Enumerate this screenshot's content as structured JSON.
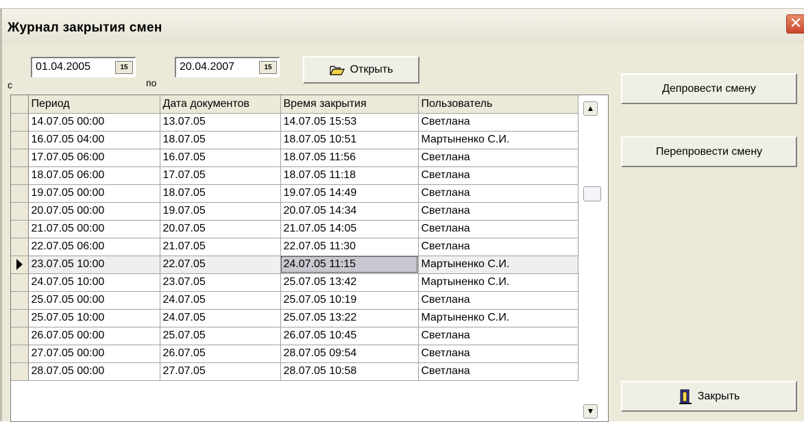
{
  "window": {
    "title": "Журнал закрытия смен",
    "close_glyph": "✕"
  },
  "filter": {
    "from_label": "с",
    "from_value": "01.04.2005",
    "to_label": "по",
    "to_value": "20.04.2007",
    "calendar_glyph": "15",
    "open_button": "Открыть",
    "open_icon": "folder-open-icon"
  },
  "actions": {
    "unpost": "Депровести смену",
    "repost": "Перепровести смену",
    "close": "Закрыть",
    "close_icon": "exit-door-icon"
  },
  "grid": {
    "columns": [
      "Период",
      "Дата документов",
      "Время закрытия",
      "Пользователь"
    ],
    "current_row_index": 8,
    "rows": [
      [
        "14.07.05 00:00",
        "13.07.05",
        "14.07.05 15:53",
        "Светлана"
      ],
      [
        "16.07.05 04:00",
        "18.07.05",
        "18.07.05 10:51",
        "Мартыненко С.И."
      ],
      [
        "17.07.05 06:00",
        "16.07.05",
        "18.07.05 11:56",
        "Светлана"
      ],
      [
        "18.07.05 06:00",
        "17.07.05",
        "18.07.05 11:18",
        "Светлана"
      ],
      [
        "19.07.05 00:00",
        "18.07.05",
        "19.07.05 14:49",
        "Светлана"
      ],
      [
        "20.07.05 00:00",
        "19.07.05",
        "20.07.05 14:34",
        "Светлана"
      ],
      [
        "21.07.05 00:00",
        "20.07.05",
        "21.07.05 14:05",
        "Светлана"
      ],
      [
        "22.07.05 06:00",
        "21.07.05",
        "22.07.05 11:30",
        "Светлана"
      ],
      [
        "23.07.05 10:00",
        "22.07.05",
        "24.07.05 11:15",
        "Мартыненко С.И."
      ],
      [
        "24.07.05 10:00",
        "23.07.05",
        "25.07.05 13:42",
        "Мартыненко С.И."
      ],
      [
        "25.07.05 00:00",
        "24.07.05",
        "25.07.05 10:19",
        "Светлана"
      ],
      [
        "25.07.05 10:00",
        "24.07.05",
        "25.07.05 13:22",
        "Мартыненко С.И."
      ],
      [
        "26.07.05 00:00",
        "25.07.05",
        "26.07.05 10:45",
        "Светлана"
      ],
      [
        "27.07.05 00:00",
        "26.07.05",
        "28.07.05 09:54",
        "Светлана"
      ],
      [
        "28.07.05 00:00",
        "27.07.05",
        "28.07.05 10:58",
        "Светлана"
      ]
    ]
  }
}
